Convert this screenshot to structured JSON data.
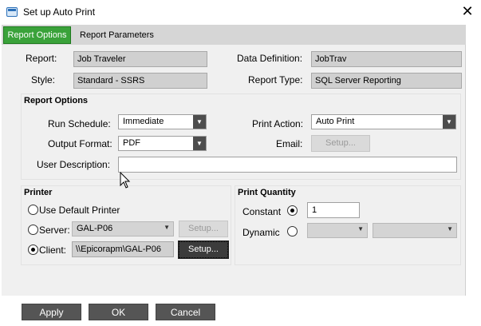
{
  "window": {
    "title": "Set up Auto Print",
    "close_glyph": "✕"
  },
  "tabs": [
    {
      "label": "Report Options",
      "active": true
    },
    {
      "label": "Report Parameters",
      "active": false
    }
  ],
  "report_info": {
    "report_label": "Report:",
    "report_value": "Job Traveler",
    "style_label": "Style:",
    "style_value": "Standard - SSRS",
    "data_def_label": "Data Definition:",
    "data_def_value": "JobTrav",
    "report_type_label": "Report Type:",
    "report_type_value": "SQL Server Reporting"
  },
  "report_options": {
    "title": "Report Options",
    "run_schedule_label": "Run Schedule:",
    "run_schedule_value": "Immediate",
    "output_format_label": "Output Format:",
    "output_format_value": "PDF",
    "print_action_label": "Print Action:",
    "print_action_value": "Auto Print",
    "email_label": "Email:",
    "email_setup_label": "Setup...",
    "user_description_label": "User Description:",
    "user_description_value": ""
  },
  "printer": {
    "title": "Printer",
    "use_default_label": "Use Default Printer",
    "server_label": "Server:",
    "server_value": "GAL-P06",
    "server_setup_label": "Setup...",
    "client_label": "Client:",
    "client_value": "\\\\Epicorapm\\GAL-P06",
    "client_setup_label": "Setup...",
    "selected": "client"
  },
  "print_quantity": {
    "title": "Print Quantity",
    "constant_label": "Constant",
    "constant_value": "1",
    "dynamic_label": "Dynamic",
    "selected": "constant"
  },
  "footer": {
    "apply_label": "Apply",
    "ok_label": "OK",
    "cancel_label": "Cancel"
  },
  "icons": {
    "combo_arrow": "▼"
  },
  "colors": {
    "active_tab": "#3aa23a",
    "button": "#555555"
  }
}
